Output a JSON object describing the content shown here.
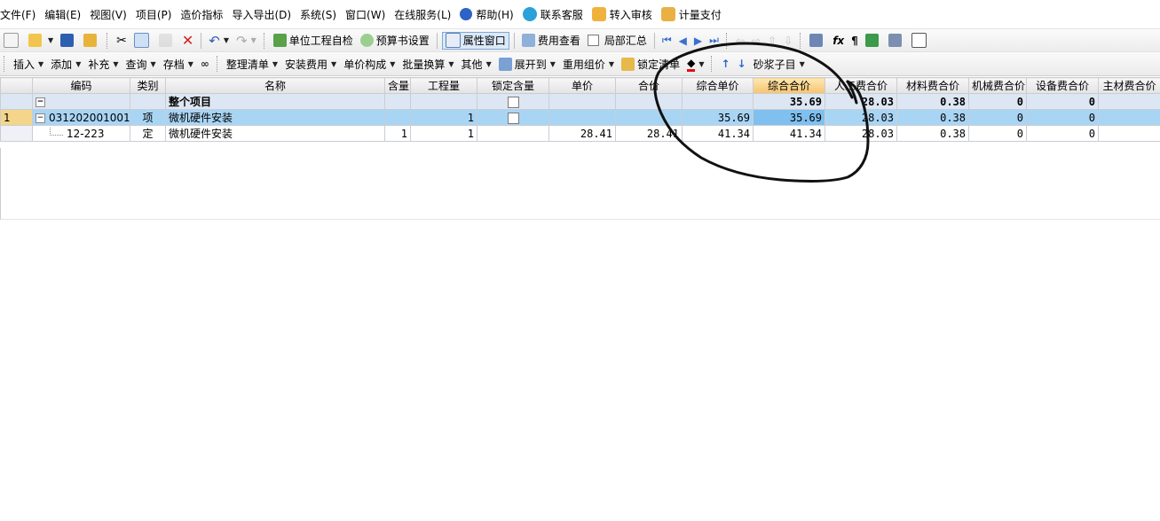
{
  "menu": {
    "items": [
      "文件(F)",
      "编辑(E)",
      "视图(V)",
      "项目(P)",
      "造价指标",
      "导入导出(D)",
      "系统(S)",
      "窗口(W)",
      "在线服务(L)"
    ],
    "help": "帮助(H)",
    "contact": "联系客服",
    "review": "转入审核",
    "pay": "计量支付"
  },
  "toolbar1": {
    "self_check": "单位工程自检",
    "budget_settings": "预算书设置",
    "property_window": "属性窗口",
    "fee_view": "费用查看",
    "local_summary": "局部汇总"
  },
  "toolbar2": {
    "insert": "插入",
    "add": "添加",
    "supplement": "补充",
    "query": "查询",
    "archive": "存档",
    "organize": "整理清单",
    "install_fee": "安装费用",
    "unit_price_composition": "单价构成",
    "batch_convert": "批量换算",
    "other": "其他",
    "expand_to": "展开到",
    "reuse_price": "重用组价",
    "lock_list": "锁定清单",
    "mortar_item": "砂浆子目"
  },
  "grid": {
    "headers": [
      "",
      "编码",
      "类别",
      "名称",
      "含量",
      "工程量",
      "锁定含量",
      "单价",
      "合价",
      "综合单价",
      "综合合价",
      "人工费合价",
      "材料费合价",
      "机械费合价",
      "设备费合价",
      "主材费合价"
    ],
    "total_row": {
      "name": "整个项目",
      "comp_total": "35.69",
      "labor": "28.03",
      "material": "0.38",
      "machine": "0",
      "equipment": "0"
    },
    "rows": [
      {
        "rownum": "1",
        "code": "031202001001",
        "type": "项",
        "name": "微机硬件安装",
        "content": "",
        "qty": "1",
        "unit_price": "",
        "total": "",
        "comp_unit": "35.69",
        "comp_total": "35.69",
        "labor": "28.03",
        "material": "0.38",
        "machine": "0",
        "equipment": "0"
      },
      {
        "rownum": "",
        "code": "12-223",
        "type": "定",
        "name": "微机硬件安装",
        "content": "1",
        "qty": "1",
        "unit_price": "28.41",
        "total": "28.41",
        "comp_unit": "41.34",
        "comp_total": "41.34",
        "labor": "28.03",
        "material": "0.38",
        "machine": "0",
        "equipment": "0"
      }
    ]
  },
  "colors": {
    "selected_row": "#a9d5f5",
    "highlight_header": "#f7c46b",
    "total_row": "#dde7f3"
  }
}
